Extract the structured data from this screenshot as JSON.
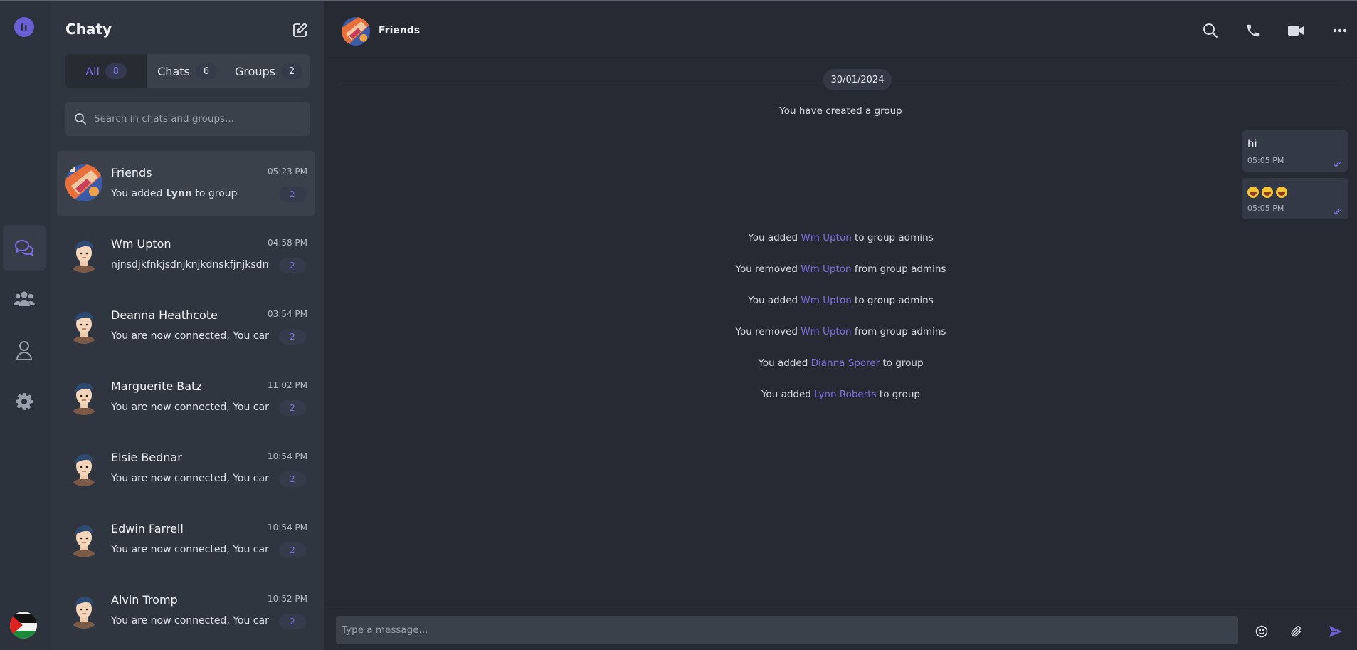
{
  "app": {
    "name": "Chaty"
  },
  "colors": {
    "accent": "#7d6fe0",
    "background": "#262b33",
    "sidebar": "#2f3640",
    "rail": "#2d333c"
  },
  "rail": {
    "items": [
      {
        "name": "chat-icon",
        "active": true
      },
      {
        "name": "contacts-icon",
        "active": false
      },
      {
        "name": "profile-icon",
        "active": false
      },
      {
        "name": "settings-icon",
        "active": false
      }
    ]
  },
  "tabs": [
    {
      "label": "All",
      "count": "8",
      "active": true
    },
    {
      "label": "Chats",
      "count": "6",
      "active": false
    },
    {
      "label": "Groups",
      "count": "2",
      "active": false
    }
  ],
  "search": {
    "placeholder": "Search in chats and groups..."
  },
  "chats": [
    {
      "name": "Friends",
      "time": "05:23 PM",
      "last_prefix": "You added ",
      "last_bold": "Lynn",
      "last_suffix": " to group",
      "unread": "2",
      "avatar": "group-avatar"
    },
    {
      "name": "Wm Upton",
      "time": "04:58 PM",
      "last_prefix": "njnsdjkfnkjsdnjknjkdnskfjnjksdnfjkjkdfnjkd",
      "last_bold": "",
      "last_suffix": "",
      "unread": "2",
      "avatar": "user-avatar"
    },
    {
      "name": "Deanna Heathcote",
      "time": "03:54 PM",
      "last_prefix": "You are now connected, You can chat now",
      "last_bold": "",
      "last_suffix": "",
      "unread": "2",
      "avatar": "user-avatar"
    },
    {
      "name": "Marguerite Batz",
      "time": "11:02 PM",
      "last_prefix": "You are now connected, You can chat now",
      "last_bold": "",
      "last_suffix": "",
      "unread": "2",
      "avatar": "user-avatar"
    },
    {
      "name": "Elsie Bednar",
      "time": "10:54 PM",
      "last_prefix": "You are now connected, You can chat now",
      "last_bold": "",
      "last_suffix": "",
      "unread": "2",
      "avatar": "user-avatar"
    },
    {
      "name": "Edwin Farrell",
      "time": "10:54 PM",
      "last_prefix": "You are now connected, You can chat now",
      "last_bold": "",
      "last_suffix": "",
      "unread": "2",
      "avatar": "user-avatar"
    },
    {
      "name": "Alvin Tromp",
      "time": "10:52 PM",
      "last_prefix": "You are now connected, You can chat now",
      "last_bold": "",
      "last_suffix": "",
      "unread": "2",
      "avatar": "user-avatar"
    }
  ],
  "conversation": {
    "title": "Friends",
    "date": "30/01/2024",
    "created": "You have created a group",
    "messages": [
      {
        "text": "hi",
        "time": "05:05 PM",
        "emojis": 0
      },
      {
        "text": "",
        "time": "05:05 PM",
        "emojis": 3
      }
    ],
    "events": [
      {
        "pre": "You added ",
        "who": "Wm Upton",
        "post": " to group admins"
      },
      {
        "pre": "You removed ",
        "who": "Wm Upton",
        "post": " from group admins"
      },
      {
        "pre": "You added ",
        "who": "Wm Upton",
        "post": " to group admins"
      },
      {
        "pre": "You removed ",
        "who": "Wm Upton",
        "post": " from group admins"
      },
      {
        "pre": "You added ",
        "who": "Dianna Sporer",
        "post": " to group"
      },
      {
        "pre": "You added ",
        "who": "Lynn Roberts",
        "post": " to group"
      }
    ]
  },
  "composer": {
    "placeholder": "Type a message..."
  }
}
